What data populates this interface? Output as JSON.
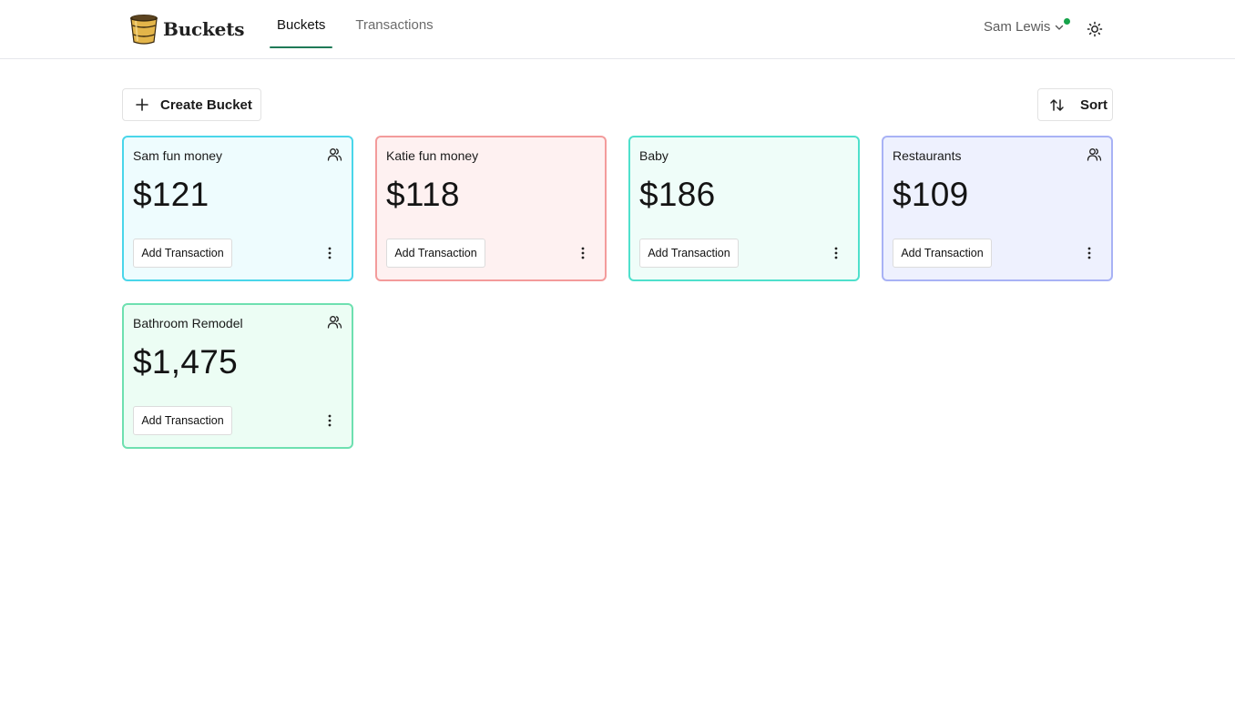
{
  "brand": {
    "name": "Buckets",
    "logo_icon": "bucket-logo-icon"
  },
  "nav": {
    "tabs": [
      {
        "label": "Buckets",
        "active": true
      },
      {
        "label": "Transactions",
        "active": false
      }
    ],
    "accent": "#1f7a57"
  },
  "user": {
    "name": "Sam Lewis",
    "status_color": "#16a34a"
  },
  "toolbar": {
    "create_label": "Create Bucket",
    "create_icon": "plus-icon",
    "sort_label": "Sort",
    "sort_icon": "sort-arrows-icon"
  },
  "buckets": [
    {
      "name": "Sam fun money",
      "amount": "$121",
      "shared": true,
      "border": "#4ad6ea",
      "bg": "#eefcfe",
      "action": "Add Transaction"
    },
    {
      "name": "Katie fun money",
      "amount": "$118",
      "shared": false,
      "border": "#f39b9b",
      "bg": "#fef1f1",
      "action": "Add Transaction"
    },
    {
      "name": "Baby",
      "amount": "$186",
      "shared": false,
      "border": "#4fe0cc",
      "bg": "#effdf9",
      "action": "Add Transaction"
    },
    {
      "name": "Restaurants",
      "amount": "$109",
      "shared": true,
      "border": "#a8b2f5",
      "bg": "#eef1fe",
      "action": "Add Transaction"
    },
    {
      "name": "Bathroom Remodel",
      "amount": "$1,475",
      "shared": true,
      "border": "#6ee0b0",
      "bg": "#ecfdf4",
      "action": "Add Transaction"
    }
  ]
}
